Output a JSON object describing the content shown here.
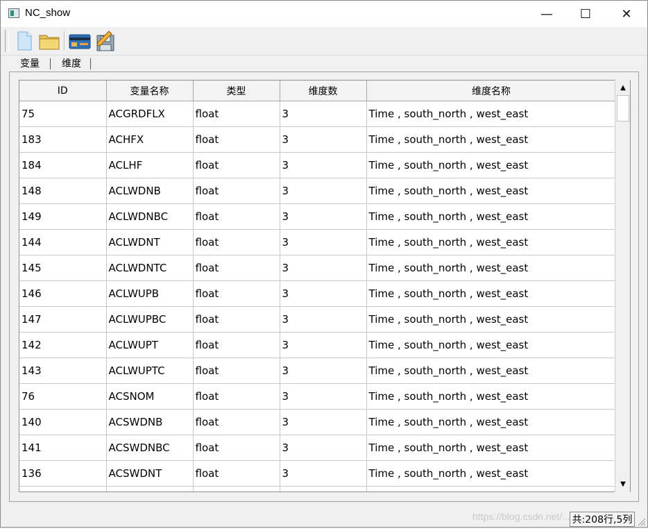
{
  "window": {
    "title": "NC_show",
    "minimize": "—",
    "maximize": "☐",
    "close": "✕"
  },
  "toolbar": {
    "items": [
      {
        "icon": "new-file-icon"
      },
      {
        "icon": "open-folder-icon"
      },
      {
        "icon": "card-icon"
      },
      {
        "icon": "save-icon"
      }
    ]
  },
  "tabs": [
    {
      "label": "变量"
    },
    {
      "label": "维度"
    }
  ],
  "table": {
    "headers": [
      "ID",
      "变量名称",
      "类型",
      "维度数",
      "维度名称"
    ],
    "rows": [
      [
        "75",
        "ACGRDFLX",
        "float",
        "3",
        "Time , south_north , west_east"
      ],
      [
        "183",
        "ACHFX",
        "float",
        "3",
        "Time , south_north , west_east"
      ],
      [
        "184",
        "ACLHF",
        "float",
        "3",
        "Time , south_north , west_east"
      ],
      [
        "148",
        "ACLWDNB",
        "float",
        "3",
        "Time , south_north , west_east"
      ],
      [
        "149",
        "ACLWDNBC",
        "float",
        "3",
        "Time , south_north , west_east"
      ],
      [
        "144",
        "ACLWDNT",
        "float",
        "3",
        "Time , south_north , west_east"
      ],
      [
        "145",
        "ACLWDNTC",
        "float",
        "3",
        "Time , south_north , west_east"
      ],
      [
        "146",
        "ACLWUPB",
        "float",
        "3",
        "Time , south_north , west_east"
      ],
      [
        "147",
        "ACLWUPBC",
        "float",
        "3",
        "Time , south_north , west_east"
      ],
      [
        "142",
        "ACLWUPT",
        "float",
        "3",
        "Time , south_north , west_east"
      ],
      [
        "143",
        "ACLWUPTC",
        "float",
        "3",
        "Time , south_north , west_east"
      ],
      [
        "76",
        "ACSNOM",
        "float",
        "3",
        "Time , south_north , west_east"
      ],
      [
        "140",
        "ACSWDNB",
        "float",
        "3",
        "Time , south_north , west_east"
      ],
      [
        "141",
        "ACSWDNBC",
        "float",
        "3",
        "Time , south_north , west_east"
      ],
      [
        "136",
        "ACSWDNT",
        "float",
        "3",
        "Time , south_north , west_east"
      ],
      [
        "",
        "",
        "",
        "",
        ""
      ]
    ]
  },
  "scrollbar": {
    "up": "▲",
    "down": "▼"
  },
  "status": {
    "text": "共:208行,5列"
  },
  "watermark": "https://blog.csdn.net/..."
}
